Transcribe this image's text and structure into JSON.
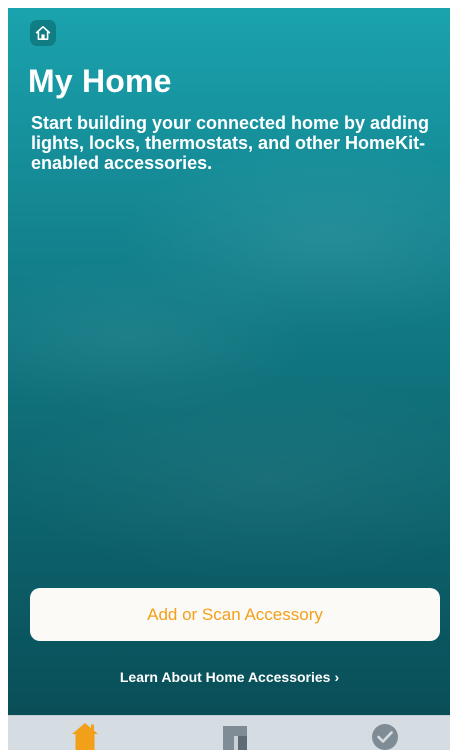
{
  "header": {
    "home_icon": "home-icon"
  },
  "main": {
    "title": "My Home",
    "subtitle": "Start building your connected home by adding lights, locks, thermostats, and other HomeKit-enabled accessories.",
    "add_button_label": "Add or Scan Accessory",
    "learn_link_label": "Learn About Home Accessories",
    "learn_link_chevron": "›"
  },
  "tab_bar": {
    "tabs": [
      {
        "name": "home",
        "icon": "home-icon",
        "active": true
      },
      {
        "name": "rooms",
        "icon": "rooms-icon",
        "active": false
      },
      {
        "name": "automation",
        "icon": "checkmark-circle-icon",
        "active": false
      }
    ]
  },
  "colors": {
    "accent": "#f2a01a",
    "background_top": "#1aa3ae",
    "background_bottom": "#094b54",
    "tab_bar": "#d6dde2",
    "inactive_tab_icon": "#7f8c95"
  }
}
